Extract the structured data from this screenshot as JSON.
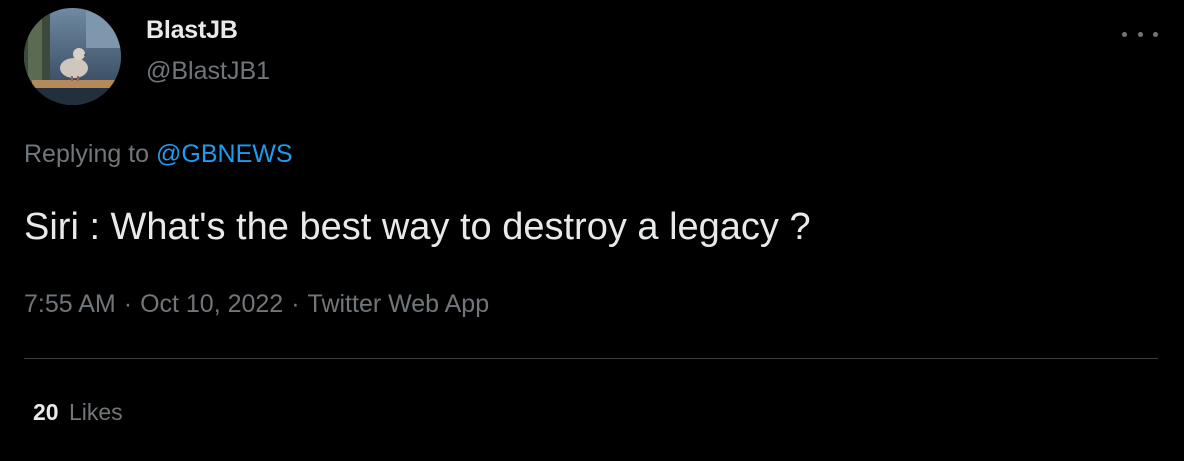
{
  "author": {
    "display_name": "BlastJB",
    "handle": "@BlastJB1",
    "avatar": "pigeon-photo-avatar"
  },
  "more_icon": "more-horizontal-icon",
  "reply_context": {
    "prefix": "Replying to",
    "mention": "@GBNEWS"
  },
  "tweet": {
    "text": "Siri : What's the best way to destroy a legacy ?"
  },
  "meta": {
    "time": "7:55 AM",
    "separator": "·",
    "date": "Oct 10, 2022",
    "source": "Twitter Web App"
  },
  "stats": {
    "likes_count": "20",
    "likes_label": "Likes"
  },
  "colors": {
    "background": "#000000",
    "text_primary": "#e7e9ea",
    "text_secondary": "#71767b",
    "link": "#1d9bf0",
    "divider": "#3a3d41"
  }
}
